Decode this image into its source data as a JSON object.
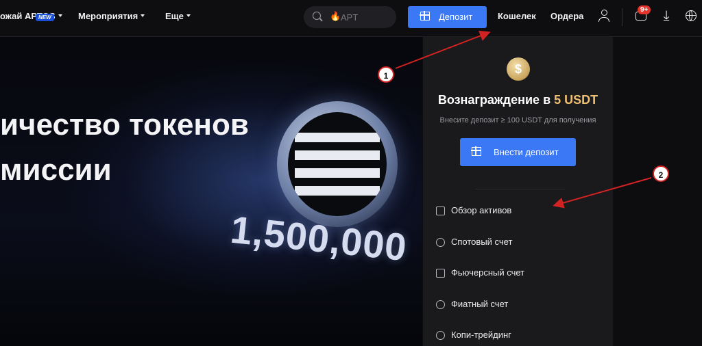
{
  "header": {
    "nav": [
      {
        "label": "ожай APTOS",
        "has_caret": true,
        "badge": "NEW"
      },
      {
        "label": "Мероприятия",
        "has_caret": true
      },
      {
        "label": "Еще",
        "has_caret": true
      }
    ],
    "search": {
      "placeholder": "APT",
      "icon": "search-icon"
    },
    "deposit_button": {
      "label": "Депозит",
      "icon": "gift-icon"
    },
    "links": [
      "Кошелек",
      "Ордера"
    ],
    "notifications_badge": "9+",
    "icons": [
      "user-icon",
      "chat-icon",
      "download-icon",
      "globe-icon"
    ]
  },
  "hero": {
    "title_lines": [
      "ичество токенов",
      "миссии"
    ],
    "big_number": "1,500,000"
  },
  "dropdown": {
    "reward_title_prefix": "Вознаграждение в ",
    "reward_title_amount": "5 USDT",
    "reward_subtitle": "Внесите депозит ≥ 100 USDT для получения",
    "deposit_button": "Внести депозит",
    "menu": [
      {
        "label": "Обзор активов",
        "icon": "wallet-icon"
      },
      {
        "label": "Спотовый счет",
        "icon": "spot-icon"
      },
      {
        "label": "Фьючерсный счет",
        "icon": "futures-icon"
      },
      {
        "label": "Фиатный счет",
        "icon": "fiat-icon"
      },
      {
        "label": "Копи-трейдинг",
        "icon": "copy-trading-icon"
      }
    ]
  },
  "annotations": [
    "1",
    "2"
  ],
  "colors": {
    "accent_blue": "#3b78f6",
    "reward_gold": "#f0c070",
    "annotation_red": "#d32222"
  }
}
